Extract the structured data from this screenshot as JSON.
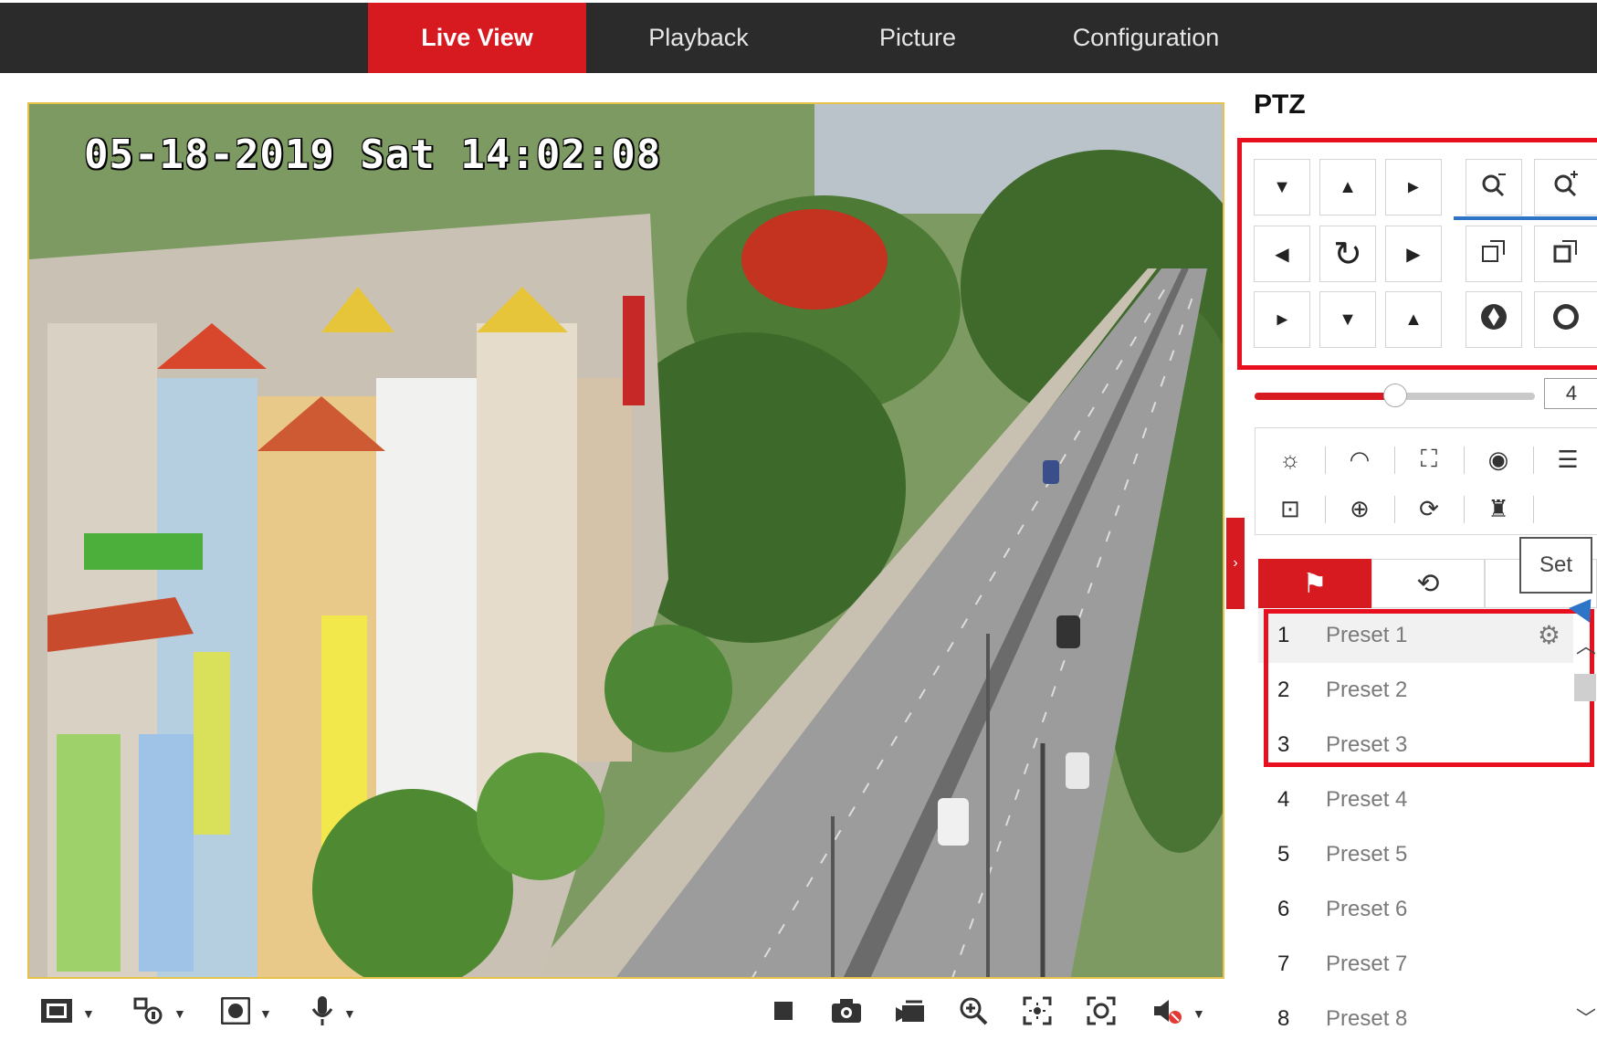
{
  "nav": {
    "tabs": [
      {
        "label": "Live View",
        "active": true
      },
      {
        "label": "Playback",
        "active": false
      },
      {
        "label": "Picture",
        "active": false
      },
      {
        "label": "Configuration",
        "active": false
      }
    ]
  },
  "video": {
    "osd_timestamp": "05-18-2019 Sat 14:02:08"
  },
  "toolbar": {
    "left_icons": [
      "window-layout-icon",
      "stream-type-icon",
      "plugin-icon",
      "microphone-icon"
    ],
    "right_icons": [
      "stop-icon",
      "capture-icon",
      "record-icon",
      "digital-zoom-icon",
      "regional-exposure-icon",
      "regional-focus-icon",
      "audio-mute-icon"
    ]
  },
  "ptz": {
    "title": "PTZ",
    "speed_value": "4",
    "speed_level_fraction": 0.5,
    "directions": [
      "up-left",
      "up",
      "up-right",
      "left",
      "auto-pan",
      "right",
      "down-left",
      "down",
      "down-right"
    ],
    "lens": [
      "zoom-out",
      "zoom-in",
      "focus-near",
      "focus-far",
      "iris-close",
      "iris-open"
    ],
    "functions": [
      "light-icon",
      "wiper-icon",
      "one-touch-focus-icon",
      "lens-init-icon",
      "menu-icon",
      "aux-focus-icon",
      "3d-zoom-icon",
      "manual-tracking-icon",
      "park-icon"
    ],
    "set_tooltip": "Set",
    "preset_tabs": [
      "preset-flag-icon",
      "patrol-icon"
    ],
    "presets": [
      {
        "num": "1",
        "name": "Preset 1"
      },
      {
        "num": "2",
        "name": "Preset 2"
      },
      {
        "num": "3",
        "name": "Preset 3"
      },
      {
        "num": "4",
        "name": "Preset 4"
      },
      {
        "num": "5",
        "name": "Preset 5"
      },
      {
        "num": "6",
        "name": "Preset 6"
      },
      {
        "num": "7",
        "name": "Preset 7"
      },
      {
        "num": "8",
        "name": "Preset 8"
      }
    ]
  },
  "colors": {
    "accent_red": "#d71920",
    "nav_bg": "#2b2b2b",
    "highlight_red": "#e8101e",
    "annotation_blue": "#2e75c8"
  }
}
